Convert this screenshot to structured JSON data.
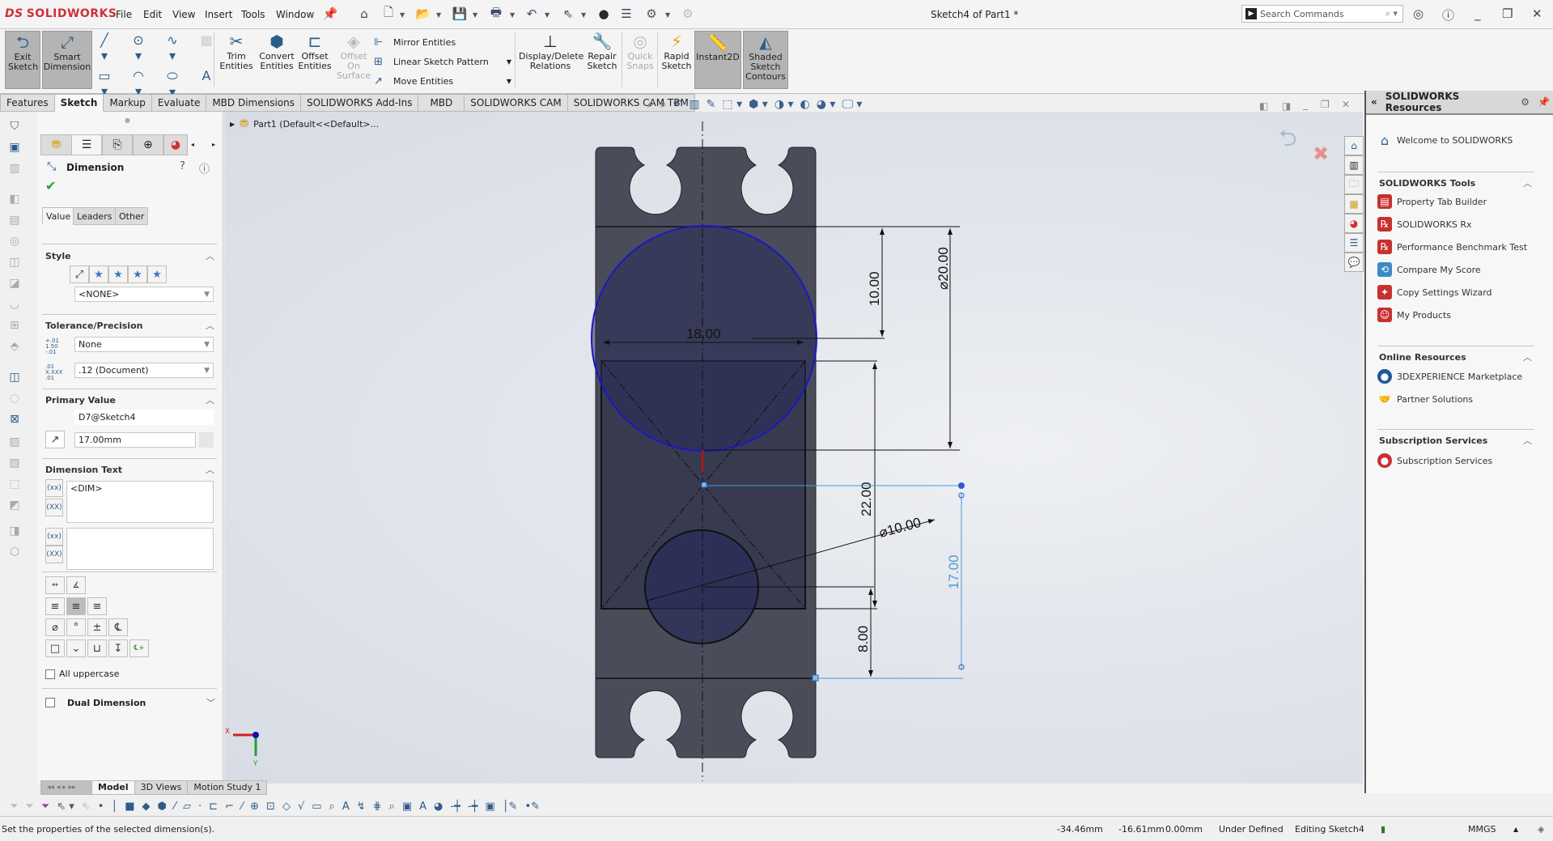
{
  "app": {
    "brand": "SOLIDWORKS",
    "menus": [
      "File",
      "Edit",
      "View",
      "Insert",
      "Tools",
      "Window"
    ],
    "doc_title": "Sketch4 of Part1 *",
    "search_placeholder": "Search Commands"
  },
  "ribbon": {
    "exit_sketch": "Exit Sketch",
    "smart_dimension": "Smart Dimension",
    "trim_entities": "Trim Entities",
    "convert_entities": "Convert Entities",
    "offset_entities": "Offset Entities",
    "offset_on_surface": "Offset On Surface",
    "mirror_entities": "Mirror Entities",
    "linear_sketch_pattern": "Linear Sketch Pattern",
    "move_entities": "Move Entities",
    "display_delete_relations": "Display/Delete Relations",
    "repair_sketch": "Repair Sketch",
    "quick_snaps": "Quick Snaps",
    "rapid_sketch": "Rapid Sketch",
    "instant2d": "Instant2D",
    "shaded_sketch_contours": "Shaded Sketch Contours"
  },
  "command_tabs": [
    "Features",
    "Sketch",
    "Markup",
    "Evaluate",
    "MBD Dimensions",
    "SOLIDWORKS Add-Ins",
    "MBD",
    "SOLIDWORKS CAM",
    "SOLIDWORKS CAM TBM"
  ],
  "active_command_tab": "Sketch",
  "tree": {
    "root": "Part1  (Default<<Default>..."
  },
  "property_manager": {
    "title": "Dimension",
    "subtabs": [
      "Value",
      "Leaders",
      "Other"
    ],
    "style": {
      "label": "Style",
      "selected": "<NONE>"
    },
    "tolerance": {
      "label": "Tolerance/Precision",
      "tolerance_type": "None",
      "precision": ".12 (Document)"
    },
    "primary_value": {
      "label": "Primary Value",
      "name": "D7@Sketch4",
      "value": "17.00mm"
    },
    "dimension_text": {
      "label": "Dimension Text",
      "text1": "<DIM>",
      "text2": ""
    },
    "symbols_row1": [
      "⌀",
      "°",
      "±",
      "℄"
    ],
    "symbols_row2": [
      "□",
      "⌄",
      "⊔",
      "↧",
      "℄+"
    ],
    "all_uppercase": {
      "label": "All uppercase",
      "checked": false
    },
    "dual_dimension": {
      "label": "Dual Dimension",
      "checked": false
    }
  },
  "sketch": {
    "dims": {
      "width": "18.00",
      "dist_top": "10.00",
      "circle_large": "⌀20.00",
      "rect_height": "22.00",
      "circle_small": "⌀10.00",
      "dist_bottom": "8.00",
      "selected": "17.00"
    },
    "colors": {
      "selected_dim": "#4a9ad8",
      "circle_selected": "#1818c8",
      "part_face": "#4a4d59"
    }
  },
  "task_pane": {
    "title": "SOLIDWORKS Resources",
    "welcome": "Welcome to SOLIDWORKS",
    "sections": [
      {
        "title": "SOLIDWORKS Tools",
        "items": [
          "Property Tab Builder",
          "SOLIDWORKS Rx",
          "Performance Benchmark Test",
          "Compare My Score",
          "Copy Settings Wizard",
          "My Products"
        ]
      },
      {
        "title": "Online Resources",
        "items": [
          "3DEXPERIENCE Marketplace",
          "Partner Solutions"
        ]
      },
      {
        "title": "Subscription Services",
        "items": [
          "Subscription Services"
        ]
      }
    ]
  },
  "model_tabs": [
    "Model",
    "3D Views",
    "Motion Study 1"
  ],
  "active_model_tab": "Model",
  "status": {
    "message": "Set the properties of the selected dimension(s).",
    "x": "-34.46mm",
    "y": "-16.61mm",
    "z": "0.00mm",
    "state": "Under Defined",
    "editing": "Editing Sketch4",
    "units": "MMGS"
  },
  "triad": {
    "x": "X",
    "y": "Y"
  }
}
